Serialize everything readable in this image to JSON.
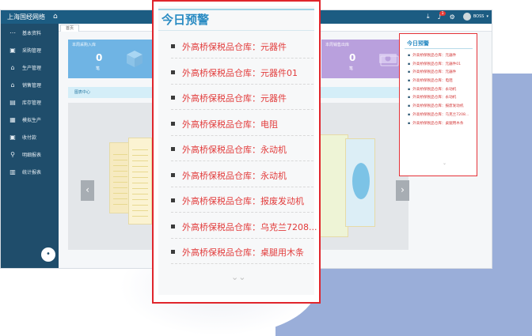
{
  "app": {
    "title": "上海国经网络",
    "user": "BOSS",
    "notification_count": "1"
  },
  "sidebar": {
    "items": [
      {
        "icon": "menu-icon",
        "glyph": "⋯",
        "label": "基本资料"
      },
      {
        "icon": "cart-icon",
        "glyph": "▣",
        "label": "采购管理"
      },
      {
        "icon": "production-icon",
        "glyph": "⌂",
        "label": "生产管理"
      },
      {
        "icon": "sales-icon",
        "glyph": "⌂",
        "label": "销售管理"
      },
      {
        "icon": "inventory-icon",
        "glyph": "▤",
        "label": "库存管理"
      },
      {
        "icon": "calendar-icon",
        "glyph": "▦",
        "label": "模拟生产"
      },
      {
        "icon": "payment-icon",
        "glyph": "▣",
        "label": "收付款"
      },
      {
        "icon": "search-icon",
        "glyph": "⚲",
        "label": "明细报表"
      },
      {
        "icon": "stats-icon",
        "glyph": "▥",
        "label": "统计报表"
      }
    ],
    "fab_glyph": "•"
  },
  "main": {
    "tab_label": "首页",
    "cards": [
      {
        "title": "本周采购入库",
        "value": "0",
        "unit": "笔"
      },
      {
        "title": "本周销售出库",
        "value": "0",
        "unit": "笔"
      }
    ],
    "section_title": "图表中心"
  },
  "alerts_small": {
    "title": "今日预警",
    "items": [
      "外高桥保税品仓库：元器件",
      "外高桥保税品仓库：元器件01",
      "外高桥保税品仓库：元器件",
      "外高桥保税品仓库：电阻",
      "外高桥保税品仓库：永动机",
      "外高桥保税品仓库：永动机",
      "外高桥保税品仓库：报废发动机",
      "外高桥保税品仓库：乌克兰7208...",
      "外高桥保税品仓库：桌腿用木条"
    ],
    "more_glyph": "⌄"
  },
  "alerts_big": {
    "title": "今日预警",
    "items": [
      "外高桥保税品仓库：元器件",
      "外高桥保税品仓库：元器件01",
      "外高桥保税品仓库：元器件",
      "外高桥保税品仓库：电阻",
      "外高桥保税品仓库：永动机",
      "外高桥保税品仓库：永动机",
      "外高桥保税品仓库：报废发动机",
      "外高桥保税品仓库：乌克兰7208...",
      "外高桥保税品仓库：桌腿用木条"
    ],
    "more_glyph": "⌄⌄"
  },
  "colors": {
    "topbar": "#1c5c82",
    "sidebar": "#1f4d6b",
    "alert_text": "#e23c3c",
    "title_blue": "#2a8bc3",
    "highlight_border": "#e0252c",
    "backdrop": "#9aaed9"
  }
}
